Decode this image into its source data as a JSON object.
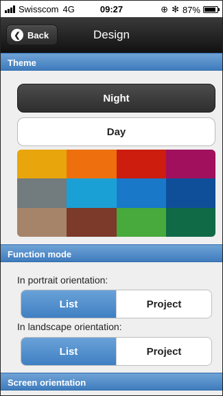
{
  "status_bar": {
    "carrier": "Swisscom",
    "network": "4G",
    "time": "09:27",
    "battery": "87%",
    "battery_level": 0.87
  },
  "navbar": {
    "back_label": "Back",
    "title": "Design"
  },
  "sections": {
    "theme": "Theme",
    "function_mode": "Function mode",
    "screen_orientation": "Screen orientation"
  },
  "theme": {
    "night_label": "Night",
    "day_label": "Day",
    "colors": [
      "#e8a50c",
      "#ed6f0e",
      "#cc1d0e",
      "#a0105c",
      "#727b7e",
      "#1ba0d6",
      "#1a78c9",
      "#0f4f9a",
      "#a6846a",
      "#7b3a2a",
      "#48a93c",
      "#0f6a45"
    ]
  },
  "function_mode": {
    "portrait_label": "In portrait orientation:",
    "landscape_label": "In landscape orientation:",
    "list_label": "List",
    "project_label": "Project",
    "portrait_selected": "List",
    "landscape_selected": "List"
  },
  "colors": {
    "accent": "#3f7cbd",
    "navbar": "#1a1a1a"
  }
}
